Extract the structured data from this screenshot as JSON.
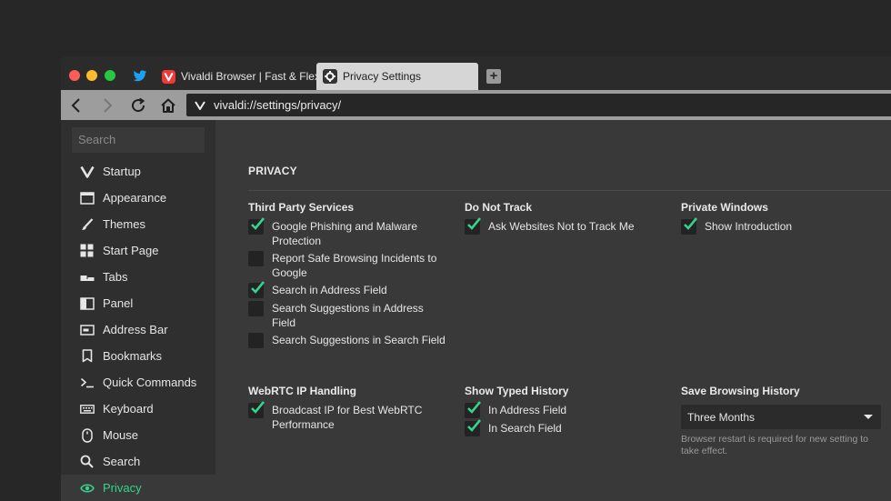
{
  "tabs": [
    {
      "label": "",
      "icon": "twitter-icon"
    },
    {
      "label": "Vivaldi Browser | Fast & Flexible",
      "icon": "vivaldi-icon"
    },
    {
      "label": "Privacy Settings",
      "icon": "gear-icon"
    }
  ],
  "new_tab_label": "+",
  "address": {
    "url": "vivaldi://settings/privacy/"
  },
  "sidebar": {
    "search_placeholder": "Search",
    "items": [
      {
        "label": "Startup",
        "icon": "vivaldi-logo-icon"
      },
      {
        "label": "Appearance",
        "icon": "window-icon"
      },
      {
        "label": "Themes",
        "icon": "brush-icon"
      },
      {
        "label": "Start Page",
        "icon": "grid-icon"
      },
      {
        "label": "Tabs",
        "icon": "tabs-icon"
      },
      {
        "label": "Panel",
        "icon": "panel-icon"
      },
      {
        "label": "Address Bar",
        "icon": "address-bar-icon"
      },
      {
        "label": "Bookmarks",
        "icon": "bookmark-icon"
      },
      {
        "label": "Quick Commands",
        "icon": "terminal-icon"
      },
      {
        "label": "Keyboard",
        "icon": "keyboard-icon"
      },
      {
        "label": "Mouse",
        "icon": "mouse-icon"
      },
      {
        "label": "Search",
        "icon": "magnifier-icon"
      },
      {
        "label": "Privacy",
        "icon": "eye-icon"
      }
    ],
    "active": "Privacy"
  },
  "main": {
    "heading": "PRIVACY",
    "sections": {
      "third_party": {
        "title": "Third Party Services",
        "options": [
          {
            "label": "Google Phishing and Malware Protection",
            "checked": true
          },
          {
            "label": "Report Safe Browsing Incidents to Google",
            "checked": false
          },
          {
            "label": "Search in Address Field",
            "checked": true
          },
          {
            "label": "Search Suggestions in Address Field",
            "checked": false
          },
          {
            "label": "Search Suggestions in Search Field",
            "checked": false
          }
        ]
      },
      "do_not_track": {
        "title": "Do Not Track",
        "options": [
          {
            "label": "Ask Websites Not to Track Me",
            "checked": true
          }
        ]
      },
      "private_windows": {
        "title": "Private Windows",
        "options": [
          {
            "label": "Show Introduction",
            "checked": true
          }
        ]
      },
      "webrtc": {
        "title": "WebRTC IP Handling",
        "options": [
          {
            "label": "Broadcast IP for Best WebRTC Performance",
            "checked": true
          }
        ]
      },
      "typed_history": {
        "title": "Show Typed History",
        "options": [
          {
            "label": "In Address Field",
            "checked": true
          },
          {
            "label": "In Search Field",
            "checked": true
          }
        ]
      },
      "browsing_history": {
        "title": "Save Browsing History",
        "selected": "Three Months",
        "note": "Browser restart is required for new setting to take effect."
      }
    }
  },
  "colors": {
    "accent": "#34d38e",
    "traffic_red": "#fc5d57",
    "traffic_yellow": "#fdbb2e",
    "traffic_green": "#28c840"
  }
}
